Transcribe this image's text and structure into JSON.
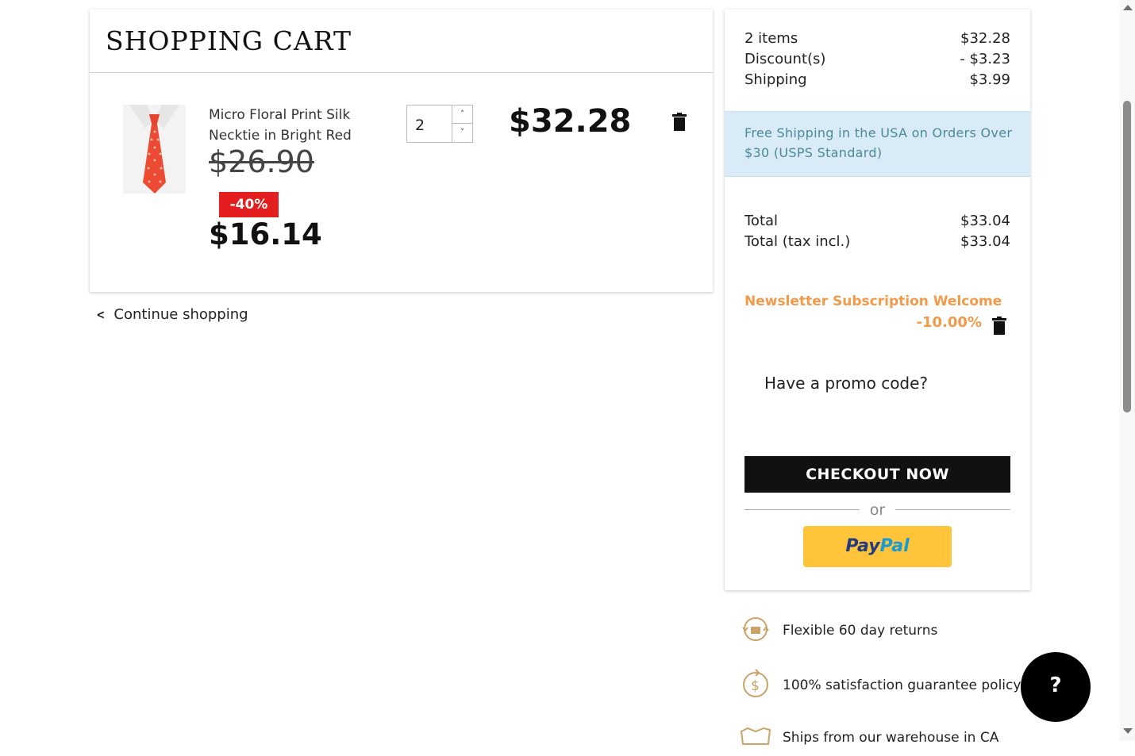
{
  "cart": {
    "title": "SHOPPING CART",
    "item": {
      "name": "Micro Floral Print Silk Necktie in Bright Red",
      "old_price": "$26.90",
      "discount_badge": "-40%",
      "new_price": "$16.14",
      "quantity": "2",
      "line_total": "$32.28"
    },
    "continue_label": "Continue shopping"
  },
  "summary": {
    "items_label": "2 items",
    "items_value": "$32.28",
    "discount_label": "Discount(s)",
    "discount_value": "- $3.23",
    "shipping_label": "Shipping",
    "shipping_value": "$3.99",
    "free_shipping_notice": "Free Shipping in the USA on Orders Over $30 (USPS Standard)",
    "total_label": "Total",
    "total_value": "$33.04",
    "total_tax_label": "Total (tax incl.)",
    "total_tax_value": "$33.04",
    "promo_name": "Newsletter Subscription Welcome",
    "promo_value": "-10.00%",
    "promo_prompt": "Have a promo code?",
    "checkout_label": "CHECKOUT NOW",
    "or_label": "or",
    "paypal_pay": "Pay",
    "paypal_pal": "Pal"
  },
  "features": [
    {
      "label": "Flexible 60 day returns",
      "icon": "returns-icon"
    },
    {
      "label": "100% satisfaction guarantee policy",
      "icon": "guarantee-icon"
    },
    {
      "label": "Ships from our warehouse in CA",
      "icon": "shipping-map-icon"
    }
  ],
  "help_label": "?",
  "colors": {
    "accent_orange": "#f39a4a",
    "badge_red": "#e41e1e",
    "banner_blue": "#d9ebf7",
    "paypal_yellow": "#ffc439",
    "icon_gold": "#c9a36a"
  }
}
